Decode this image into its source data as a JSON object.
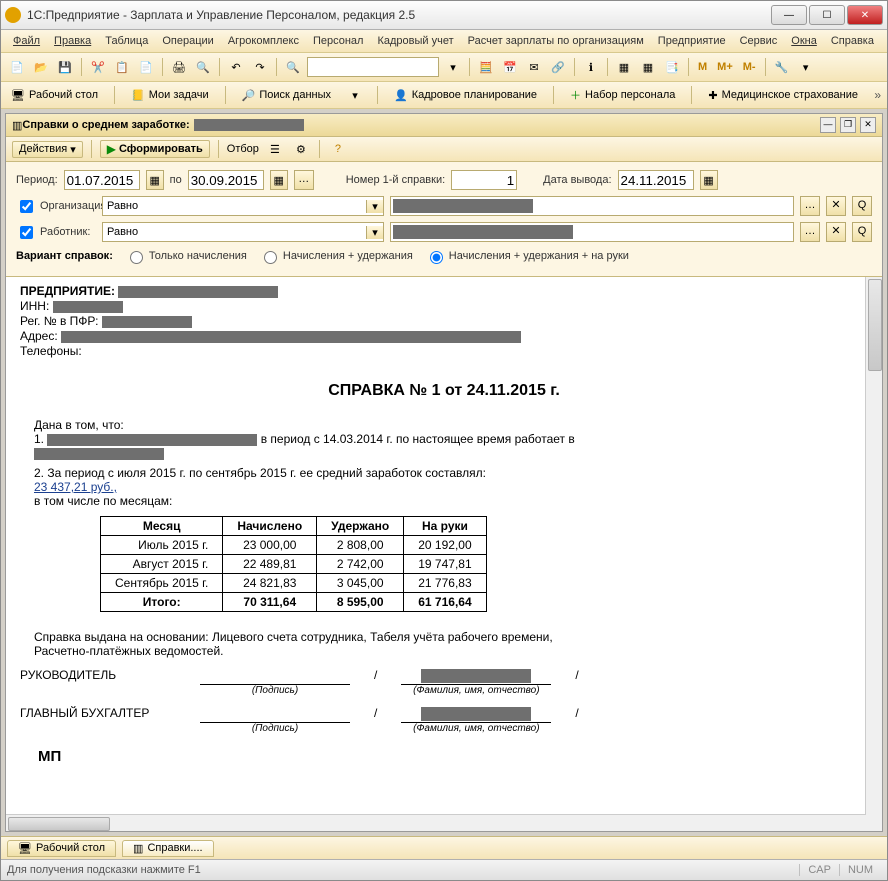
{
  "window": {
    "title": "1С:Предприятие - Зарплата и Управление Персоналом, редакция 2.5"
  },
  "menu": {
    "file": "Файл",
    "edit": "Правка",
    "table": "Таблица",
    "ops": "Операции",
    "agro": "Агрокомплекс",
    "personnel": "Персонал",
    "kadr": "Кадровый учет",
    "payroll": "Расчет зарплаты по организациям",
    "enterprise": "Предприятие",
    "service": "Сервис",
    "windows": "Окна",
    "help": "Справка"
  },
  "nav": {
    "desktop": "Рабочий стол",
    "tasks": "Мои задачи",
    "search": "Поиск данных",
    "planning": "Кадровое планирование",
    "hiring": "Набор персонала",
    "insurance": "Медицинское страхование"
  },
  "inner": {
    "title": "Справки о среднем заработке:",
    "actions": "Действия",
    "form": "Сформировать",
    "filter": "Отбор"
  },
  "filters": {
    "period_label": "Период:",
    "from": "01.07.2015",
    "to_label": "по",
    "to": "30.09.2015",
    "num_label": "Номер 1-й справки:",
    "num": "1",
    "out_date_label": "Дата вывода:",
    "out_date": "24.11.2015",
    "org_label": "Организация:",
    "org_op": "Равно",
    "emp_label": "Работник:",
    "emp_op": "Равно",
    "variant_label": "Вариант справок:",
    "opt1": "Только начисления",
    "opt2": "Начисления + удержания",
    "opt3": "Начисления + удержания + на руки"
  },
  "doc": {
    "enterprise_label": "ПРЕДПРИЯТИЕ:",
    "inn_label": "ИНН:",
    "pfr_label": "Рег. № в ПФР:",
    "address_label": "Адрес:",
    "phones_label": "Телефоны:",
    "title": "СПРАВКА № 1 от 24.11.2015 г.",
    "p1a": "Дана в том, что:",
    "p1b": "1.",
    "p1c": "в период с 14.03.2014 г. по настоящее время работает в",
    "p2": "2. За период с июля 2015  г. по сентябрь 2015  г.  ее средний заработок составлял:",
    "avg": "23 437,21 руб.,",
    "by_month": "в том числе по месяцам:",
    "basis": "Справка выдана на основании: Лицевого счета сотрудника, Табеля учёта рабочего времени, Расчетно-платёжных ведомостей.",
    "manager": "РУКОВОДИТЕЛЬ",
    "accountant": "ГЛАВНЫЙ БУХГАЛТЕР",
    "signature": "(Подпись)",
    "fio": "(Фамилия, имя, отчество)",
    "mp": "МП"
  },
  "table": {
    "h_month": "Месяц",
    "h_acc": "Начислено",
    "h_ded": "Удержано",
    "h_net": "На руки",
    "rows": [
      {
        "m": "Июль 2015 г.",
        "a": "23 000,00",
        "d": "2 808,00",
        "n": "20 192,00"
      },
      {
        "m": "Август 2015 г.",
        "a": "22 489,81",
        "d": "2 742,00",
        "n": "19 747,81"
      },
      {
        "m": "Сентябрь 2015 г.",
        "a": "24 821,83",
        "d": "3 045,00",
        "n": "21 776,83"
      }
    ],
    "total_label": "Итого:",
    "total": {
      "a": "70 311,64",
      "d": "8 595,00",
      "n": "61 716,64"
    }
  },
  "tabs": {
    "desktop": "Рабочий стол",
    "doc": "Справки...."
  },
  "status": {
    "hint": "Для получения подсказки нажмите F1",
    "cap": "CAP",
    "num": "NUM"
  }
}
